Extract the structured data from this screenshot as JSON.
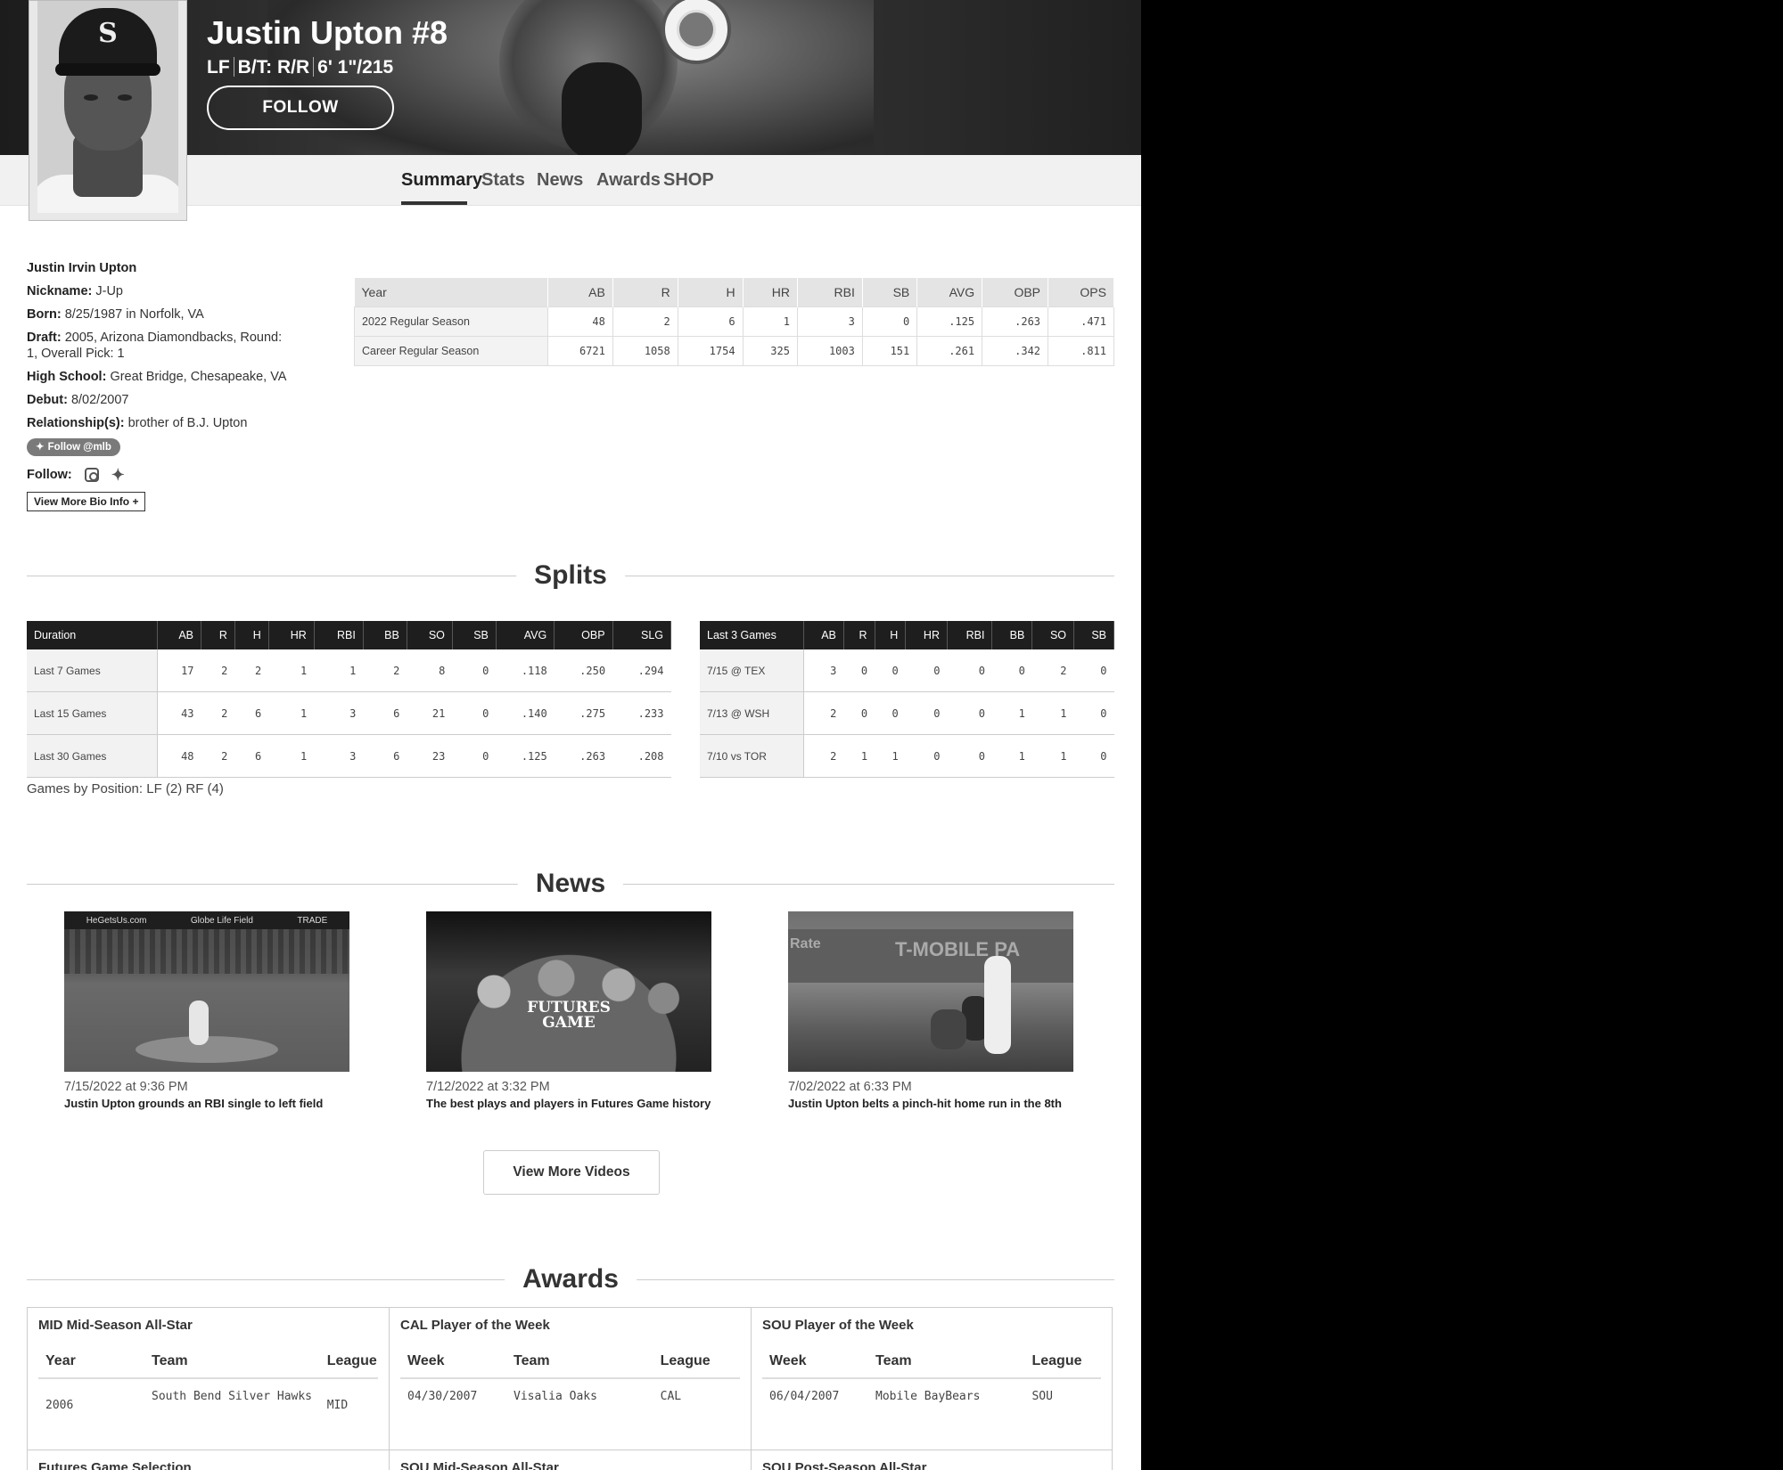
{
  "player": {
    "name": "Justin Upton #8",
    "meta_position": "LF",
    "meta_bt": "B/T: R/R",
    "meta_size": "6' 1\"/215",
    "follow_label": "FOLLOW"
  },
  "tabs": [
    "Summary",
    "Stats",
    "News",
    "Awards",
    "SHOP"
  ],
  "bio": {
    "full_name": "Justin Irvin Upton",
    "nickname_label": "Nickname:",
    "nickname": "J-Up",
    "born_label": "Born:",
    "born": "8/25/1987 in Norfolk, VA",
    "draft_label": "Draft:",
    "draft": "2005, Arizona Diamondbacks, Round: 1, Overall Pick: 1",
    "hs_label": "High School:",
    "hs": "Great Bridge, Chesapeake, VA",
    "debut_label": "Debut:",
    "debut": "8/02/2007",
    "rel_label": "Relationship(s):",
    "rel": "brother of B.J. Upton",
    "twitter_follow": "Follow @mlb",
    "follow_label": "Follow:",
    "more_bio": "View More Bio Info +"
  },
  "season_stats": {
    "headers": [
      "Year",
      "AB",
      "R",
      "H",
      "HR",
      "RBI",
      "SB",
      "AVG",
      "OBP",
      "OPS"
    ],
    "rows": [
      [
        "2022 Regular Season",
        "48",
        "2",
        "6",
        "1",
        "3",
        "0",
        ".125",
        ".263",
        ".471"
      ],
      [
        "Career Regular Season",
        "6721",
        "1058",
        "1754",
        "325",
        "1003",
        "151",
        ".261",
        ".342",
        ".811"
      ]
    ]
  },
  "splits": {
    "title": "Splits",
    "duration": {
      "headers": [
        "Duration",
        "AB",
        "R",
        "H",
        "HR",
        "RBI",
        "BB",
        "SO",
        "SB",
        "AVG",
        "OBP",
        "SLG"
      ],
      "rows": [
        [
          "Last 7 Games",
          "17",
          "2",
          "2",
          "1",
          "1",
          "2",
          "8",
          "0",
          ".118",
          ".250",
          ".294"
        ],
        [
          "Last 15 Games",
          "43",
          "2",
          "6",
          "1",
          "3",
          "6",
          "21",
          "0",
          ".140",
          ".275",
          ".233"
        ],
        [
          "Last 30 Games",
          "48",
          "2",
          "6",
          "1",
          "3",
          "6",
          "23",
          "0",
          ".125",
          ".263",
          ".208"
        ]
      ]
    },
    "last3": {
      "headers": [
        "Last 3 Games",
        "AB",
        "R",
        "H",
        "HR",
        "RBI",
        "BB",
        "SO",
        "SB"
      ],
      "rows": [
        [
          "7/15 @ TEX",
          "3",
          "0",
          "0",
          "0",
          "0",
          "0",
          "2",
          "0"
        ],
        [
          "7/13 @ WSH",
          "2",
          "0",
          "0",
          "0",
          "0",
          "1",
          "1",
          "0"
        ],
        [
          "7/10 vs TOR",
          "2",
          "1",
          "1",
          "0",
          "0",
          "1",
          "1",
          "0"
        ]
      ]
    },
    "positions": "Games by Position: LF (2) RF (4)"
  },
  "news": {
    "title": "News",
    "items": [
      {
        "date": "7/15/2022 at 9:36 PM",
        "title": "Justin Upton grounds an RBI single to left field",
        "thumb_text": [
          "HeGetsUs.com",
          "Globe Life Field",
          "TRADE"
        ]
      },
      {
        "date": "7/12/2022 at 3:32 PM",
        "title": "The best plays and players in Futures Game history",
        "thumb_text": [
          "FUTURES",
          "GAME"
        ]
      },
      {
        "date": "7/02/2022 at 6:33 PM",
        "title": "Justin Upton belts a pinch-hit home run in the 8th",
        "thumb_text": [
          "Rate",
          "T-MOBILE PA"
        ]
      }
    ],
    "more_label": "View More Videos"
  },
  "awards": {
    "title": "Awards",
    "cards": [
      {
        "title": "MID Mid-Season All-Star",
        "headers": [
          "Year",
          "Team",
          "League"
        ],
        "row": [
          "2006",
          "South Bend Silver Hawks",
          "MID"
        ]
      },
      {
        "title": "CAL Player of the Week",
        "headers": [
          "Week",
          "Team",
          "League"
        ],
        "row": [
          "04/30/2007",
          "Visalia Oaks",
          "CAL"
        ]
      },
      {
        "title": "SOU Player of the Week",
        "headers": [
          "Week",
          "Team",
          "League"
        ],
        "row": [
          "06/04/2007",
          "Mobile BayBears",
          "SOU"
        ]
      }
    ],
    "more_titles": [
      "Futures Game Selection",
      "SOU Mid-Season All-Star",
      "SOU Post-Season All-Star"
    ]
  },
  "colors": {
    "page_bg": "#ffffff",
    "outside_bg": "#000000",
    "table_head_dark": "#1e1e1e"
  }
}
